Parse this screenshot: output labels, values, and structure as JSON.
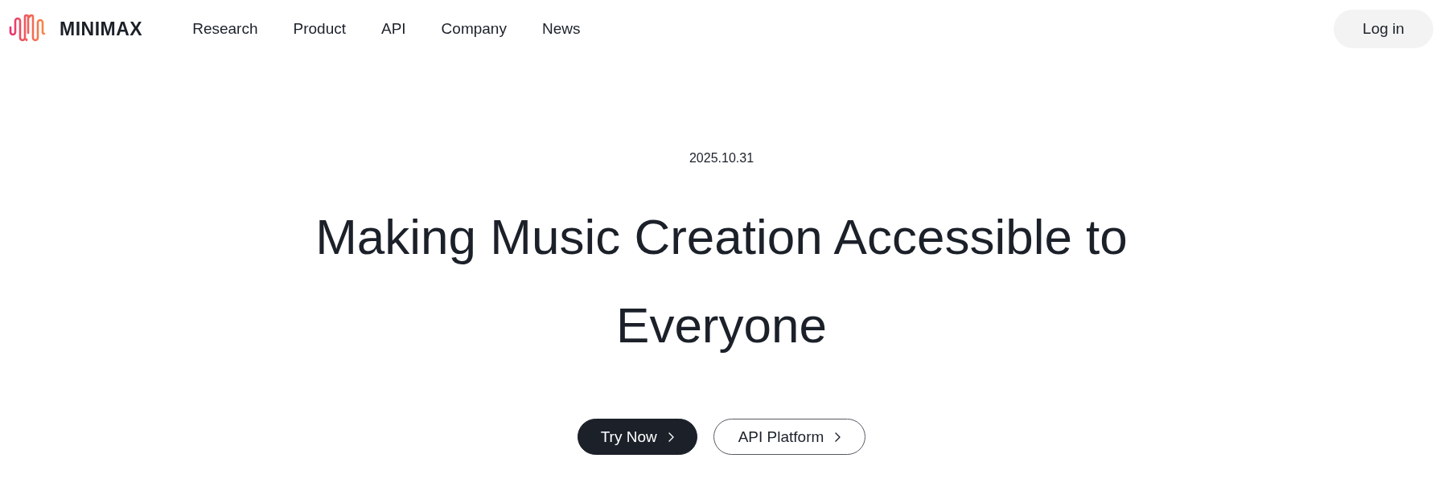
{
  "header": {
    "logo": {
      "wordmark": "MINIMAX"
    },
    "nav": [
      "Research",
      "Product",
      "API",
      "Company",
      "News"
    ],
    "login": "Log in"
  },
  "hero": {
    "date": "2025.10.31",
    "title": "Making Music Creation Accessible to Everyone",
    "buttons": [
      {
        "label": "Try Now",
        "kind": "primary"
      },
      {
        "label": "API Platform",
        "kind": "secondary"
      }
    ]
  }
}
